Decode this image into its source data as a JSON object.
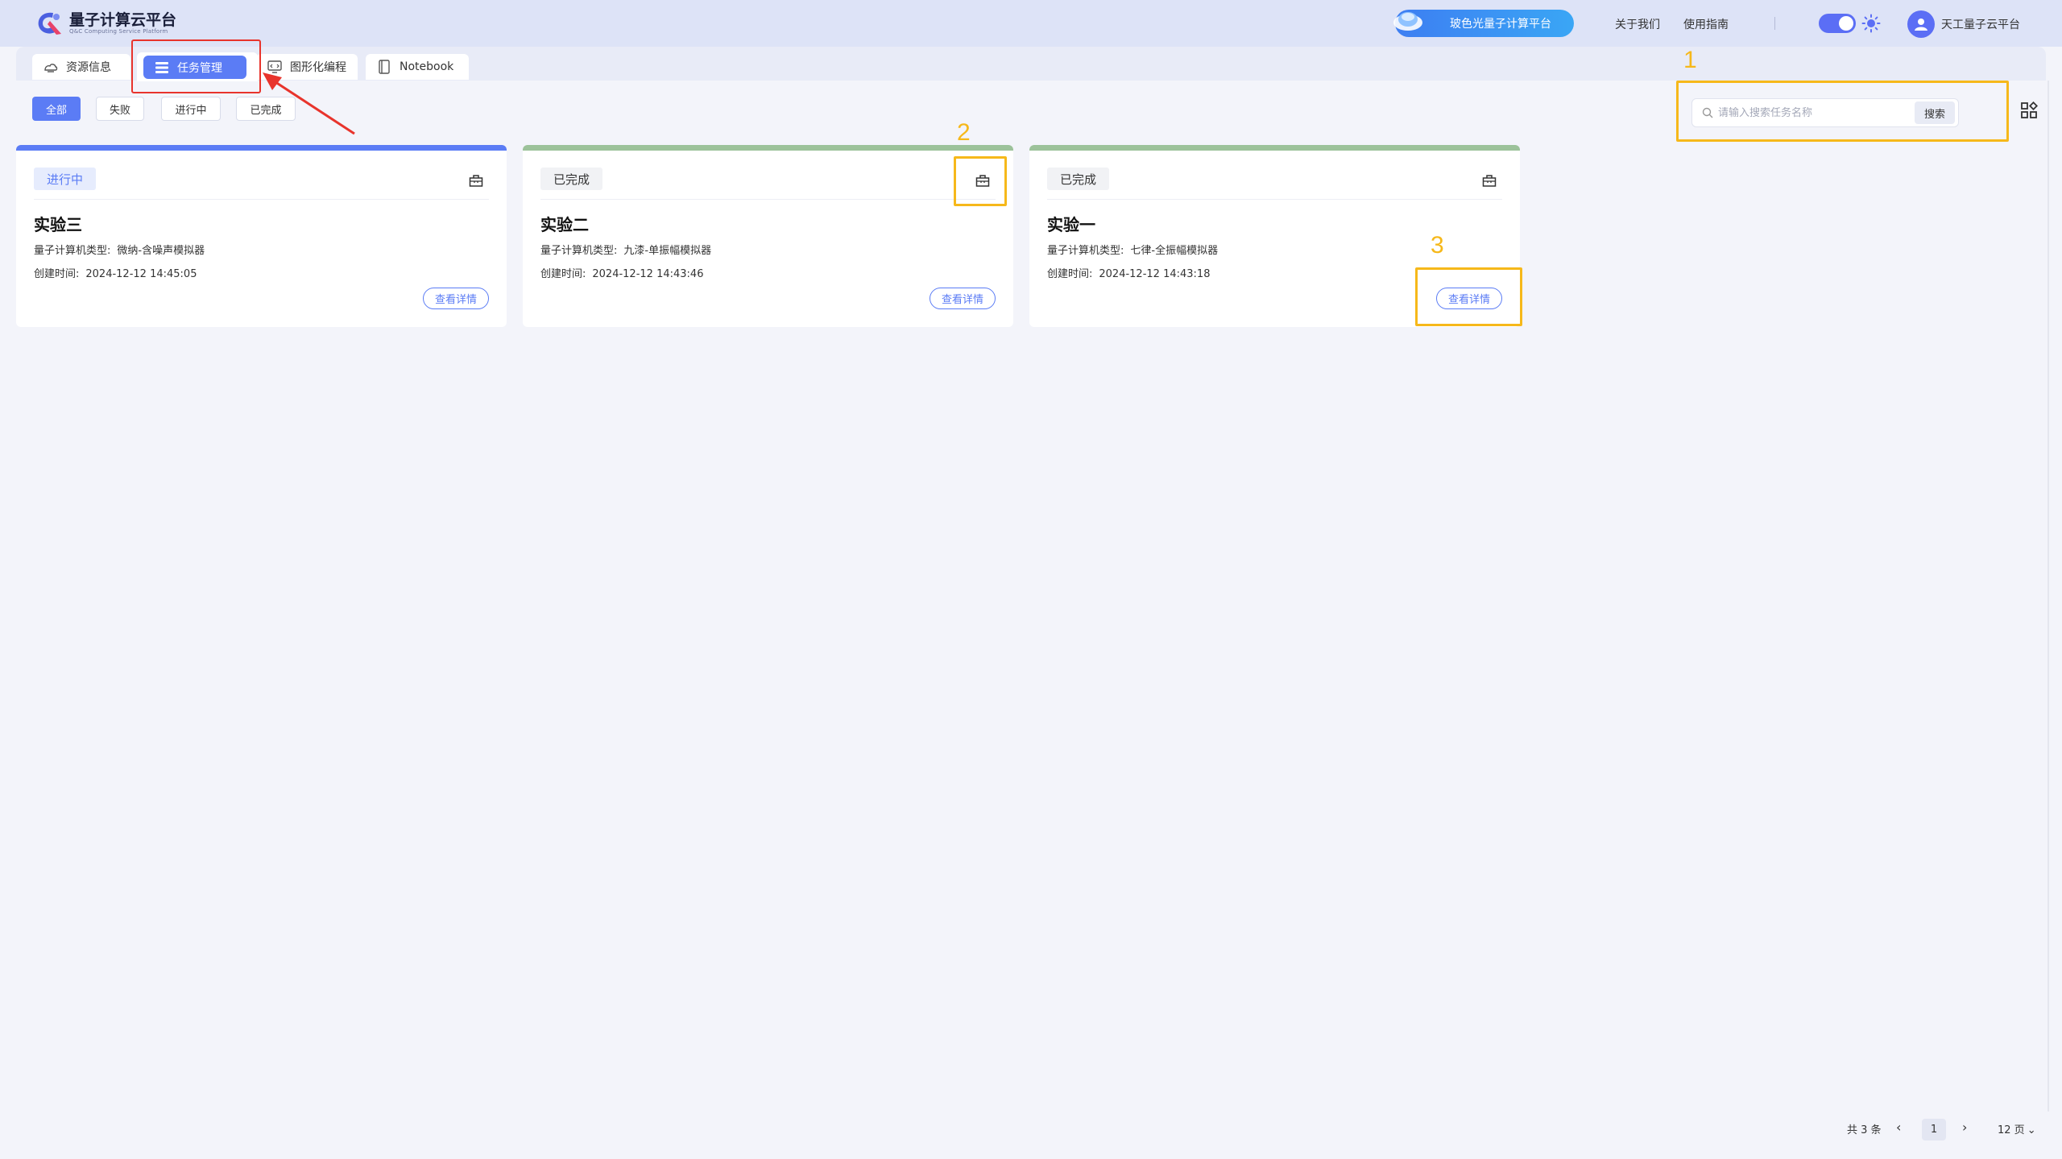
{
  "header": {
    "logo_title": "量子计算云平台",
    "logo_subtitle": "Q&C Computing Service Platform",
    "promo_label": "玻色光量子计算平台",
    "nav_about": "关于我们",
    "nav_guide": "使用指南",
    "user_name": "天工量子云平台"
  },
  "tabs": [
    {
      "label": "资源信息",
      "icon": "cloud-icon"
    },
    {
      "label": "任务管理",
      "icon": "list-icon",
      "active": true
    },
    {
      "label": "图形化编程",
      "icon": "code-icon"
    },
    {
      "label": "Notebook",
      "icon": "notebook-icon"
    }
  ],
  "filters": [
    {
      "label": "全部",
      "active": true
    },
    {
      "label": "失败"
    },
    {
      "label": "进行中"
    },
    {
      "label": "已完成"
    }
  ],
  "search": {
    "placeholder": "请输入搜索任务名称",
    "button_label": "搜索"
  },
  "cards": [
    {
      "status": "进行中",
      "title": "实验三",
      "type_label": "量子计算机类型:",
      "type_value": "微纳-含噪声模拟器",
      "time_label": "创建时间:",
      "time_value": "2024-12-12 14:45:05",
      "detail_label": "查看详情"
    },
    {
      "status": "已完成",
      "title": "实验二",
      "type_label": "量子计算机类型:",
      "type_value": "九漆-单振幅模拟器",
      "time_label": "创建时间:",
      "time_value": "2024-12-12 14:43:46",
      "detail_label": "查看详情"
    },
    {
      "status": "已完成",
      "title": "实验一",
      "type_label": "量子计算机类型:",
      "type_value": "七律-全振幅模拟器",
      "time_label": "创建时间:",
      "time_value": "2024-12-12 14:43:18",
      "detail_label": "查看详情"
    }
  ],
  "annotations": {
    "n1": "1",
    "n2": "2",
    "n3": "3"
  },
  "pagination": {
    "total": "共 3 条",
    "current_page": "1",
    "page_size": "12 页"
  },
  "colors": {
    "accent": "#5b7cf5",
    "running_bar": "#5b7cf5",
    "done_bar": "#9cc29a",
    "annotation_yellow": "#f6b81a",
    "annotation_red": "#e8342c"
  }
}
